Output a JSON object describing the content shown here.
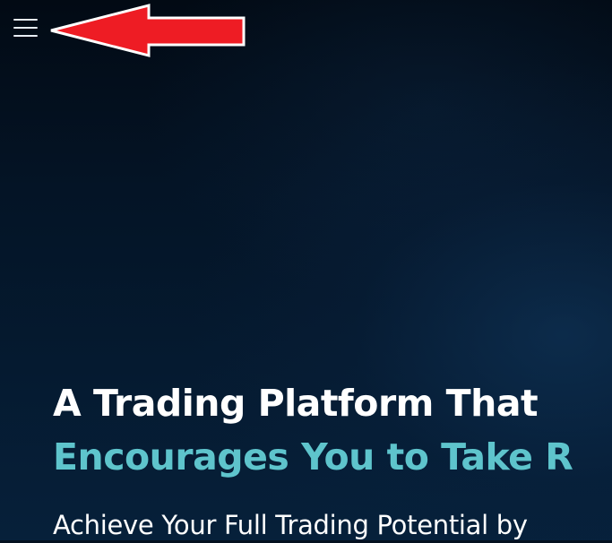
{
  "header": {
    "menu_icon": "hamburger-menu-icon"
  },
  "annotation": {
    "icon": "red-arrow-pointing-left",
    "fill_color": "#ee1c24",
    "outline_color": "#ffffff"
  },
  "hero": {
    "headline_line1": "A Trading Platform That",
    "headline_line2": "Encourages You to Take R",
    "subheadline": "Achieve Your Full Trading Potential by",
    "headline_color": "#ffffff",
    "accent_color": "#5ec4cc",
    "background_color": "#03101f"
  }
}
